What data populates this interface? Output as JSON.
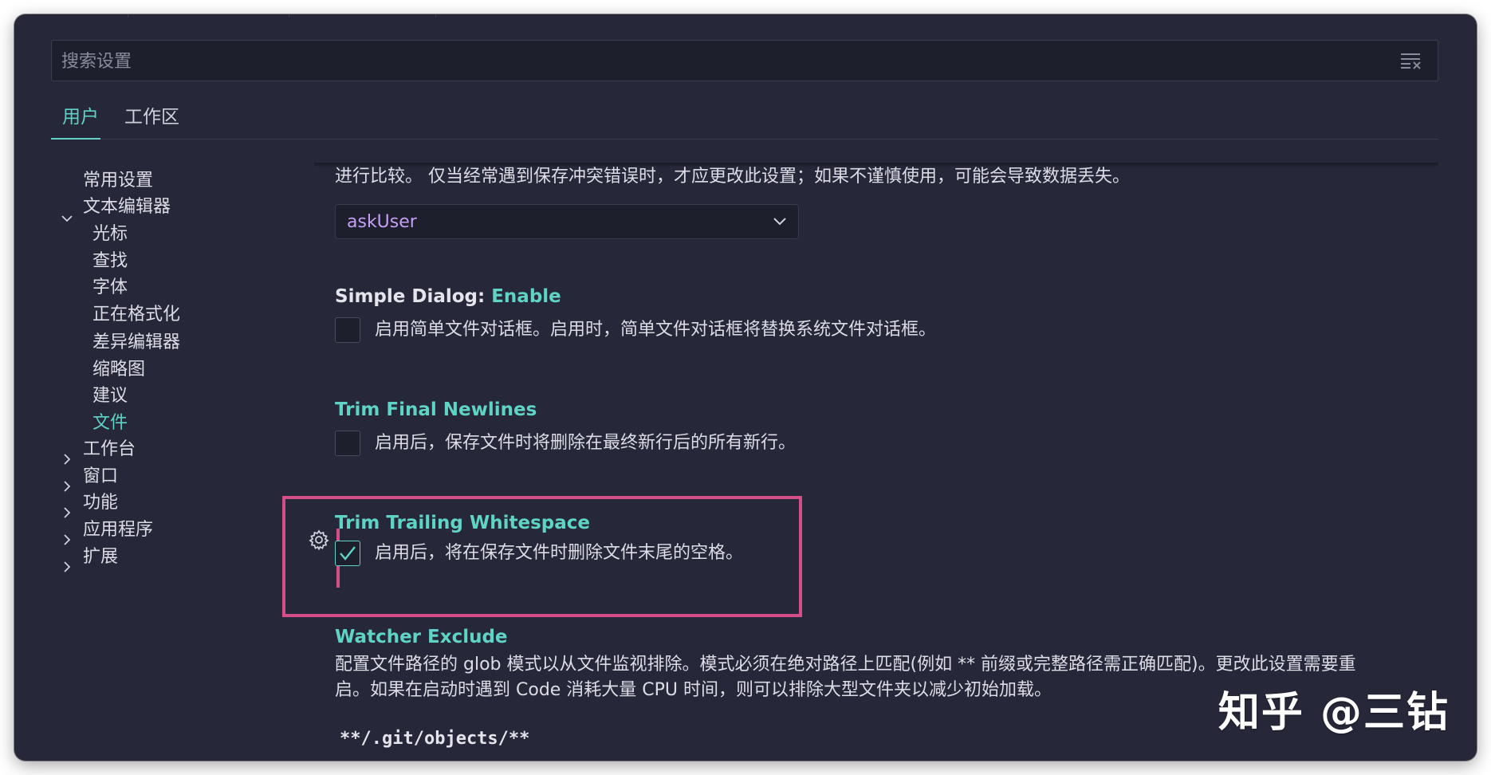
{
  "search": {
    "placeholder": "搜索设置"
  },
  "tabs": [
    {
      "label": "用户",
      "active": true
    },
    {
      "label": "工作区",
      "active": false
    }
  ],
  "tree": [
    {
      "label": "常用设置"
    },
    {
      "label": "文本编辑器",
      "expanded": true
    },
    {
      "label": "光标"
    },
    {
      "label": "查找"
    },
    {
      "label": "字体"
    },
    {
      "label": "正在格式化"
    },
    {
      "label": "差异编辑器"
    },
    {
      "label": "缩略图"
    },
    {
      "label": "建议"
    },
    {
      "label": "文件",
      "selected": true
    },
    {
      "label": "工作台",
      "expanded": false
    },
    {
      "label": "窗口",
      "expanded": false
    },
    {
      "label": "功能",
      "expanded": false
    },
    {
      "label": "应用程序",
      "expanded": false
    },
    {
      "label": "扩展",
      "expanded": false
    }
  ],
  "settings": {
    "save_conflict_desc": "进行比较。 仅当经常遇到保存冲突错误时，才应更改此设置；如果不谨慎使用，可能会导致数据丢失。",
    "save_conflict_value": "askUser",
    "simple_dialog": {
      "prefix": "Simple Dialog: ",
      "name": "Enable",
      "desc": "启用简单文件对话框。启用时，简单文件对话框将替换系统文件对话框。",
      "checked": false
    },
    "trim_final_newlines": {
      "name": "Trim Final Newlines",
      "desc": "启用后，保存文件时将删除在最终新行后的所有新行。",
      "checked": false
    },
    "trim_trailing_whitespace": {
      "name": "Trim Trailing Whitespace",
      "desc": "启用后，将在保存文件时删除文件末尾的空格。",
      "checked": true
    },
    "watcher_exclude": {
      "name": "Watcher Exclude",
      "desc_line1": "配置文件路径的 glob 模式以从文件监视排除。模式必须在绝对路径上匹配(例如 ** 前缀或完整路径需正确匹配)。更改此设置需要重",
      "desc_line2": "启。如果在启动时遇到 Code 消耗大量 CPU 时间，则可以排除大型文件夹以减少初始加载。",
      "first_pattern": "**/.git/objects/**"
    }
  },
  "watermark": "知乎 @三钻",
  "colors": {
    "background": "#262738",
    "accent": "#5fd4c6",
    "highlight": "#d44f88",
    "enum_value": "#c59ff5"
  }
}
